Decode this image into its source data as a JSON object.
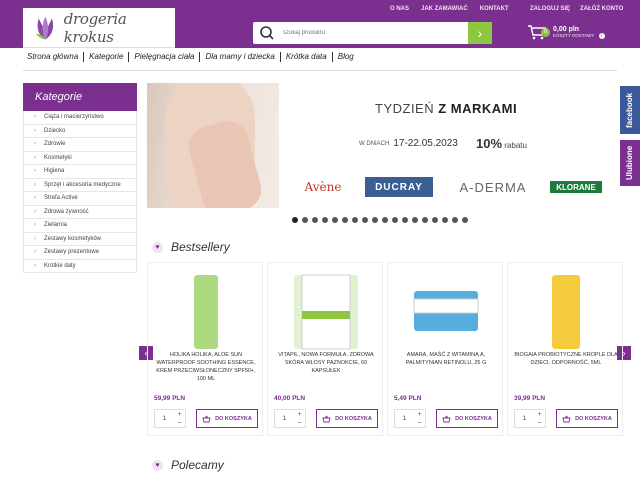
{
  "header": {
    "top_links": [
      "O NAS",
      "JAK ZAMAWIAĆ",
      "KONTAKT"
    ],
    "account_links": [
      "ZALOGUJ SIĘ",
      "ZAŁÓŻ KONTO"
    ],
    "logo_text": "drogeria krokus",
    "search_placeholder": "szukaj produktu",
    "cart_count": "0",
    "cart_total": "0,00 pln",
    "cart_shipping": "KOSZTY DOSTAWY"
  },
  "nav": [
    "Strona główna",
    "Kategorie",
    "Pielęgnacja ciała",
    "Dla mamy i dziecka",
    "Krótka data",
    "Blog"
  ],
  "sidebar": {
    "title": "Kategorie",
    "items": [
      "Ciąża i macierzyństwo",
      "Dziecko",
      "Zdrowie",
      "Kosmetyki",
      "Higiena",
      "Sprzęt i akcesoria medyczne",
      "Strefa Active",
      "Zdrowa żywność",
      "Zielarnia",
      "Zestawy kosmetyków",
      "Zestawy prezentowe",
      "Krótkie daty"
    ]
  },
  "banner": {
    "title_a": "TYDZIEŃ",
    "title_b": "Z MARKAMI",
    "dates_prefix": "W DNIACH",
    "dates": "17-22.05.2023",
    "discount": "10%",
    "discount_suffix": "rabatu",
    "brands": [
      "Avène",
      "DUCRAY",
      "A-DERMA",
      "KLORANE"
    ],
    "slides": 18
  },
  "side_tabs": {
    "facebook": "facebook",
    "ulubione": "Ulubione"
  },
  "bestsellers": {
    "title": "Bestsellery",
    "products": [
      {
        "name": "HOLIKA HOLIKA, ALOE SUN WATERPROOF SOOTHING ESSENCE, KREM PRZECIWSŁONECZNY SPF50+, 100 ML",
        "price": "59,99 PLN",
        "qty": "1",
        "img": "aloe",
        "color": "#9fd26b"
      },
      {
        "name": "VITAPIL, NOWA FORMUŁA, ZDROWA SKÓRA WŁOSY PAZNOKCIE, 60 KAPSUŁEK",
        "price": "40,00 PLN",
        "qty": "1",
        "img": "VITAPIL",
        "color": "#8dc63f"
      },
      {
        "name": "AMARA, MAŚĆ Z WITAMINĄ A, PALMITYNIAN RETINOLU, 25 G",
        "price": "5,49 PLN",
        "qty": "1",
        "img": "MAŚĆ Z WITAMINĄ A",
        "color": "#3aa0d8"
      },
      {
        "name": "BIOGAIA PROBIOTYCZNE KROPLE DLA DZIECI, ODPORNOŚĆ, 5ML",
        "price": "39,99 PLN",
        "qty": "1",
        "img": "BioGaia",
        "color": "#f3c21b"
      }
    ],
    "add_label": "DO KOSZYKA"
  },
  "recommended": {
    "title": "Polecamy"
  }
}
